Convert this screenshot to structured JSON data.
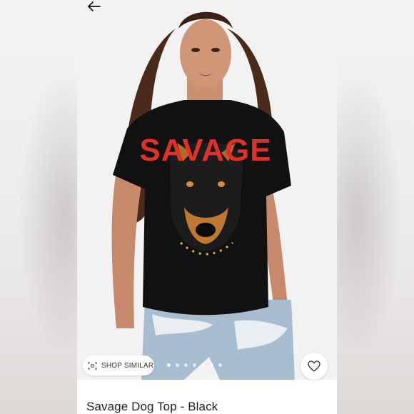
{
  "colors": {
    "graphic_text": "#e0302a",
    "shirt": "#111111",
    "denim": "#a9bdd0",
    "title_text": "#222222"
  },
  "header": {
    "back_icon": "arrow-left-icon"
  },
  "gallery": {
    "shop_similar_label": "SHOP SIMILAR",
    "shop_similar_icon": "camera-scan-icon",
    "page_count": 7,
    "active_index": 0,
    "favorite_icon": "heart-outline-icon",
    "graphic_text": "SAVAGE"
  },
  "product": {
    "title": "Savage Dog Top - Black"
  }
}
